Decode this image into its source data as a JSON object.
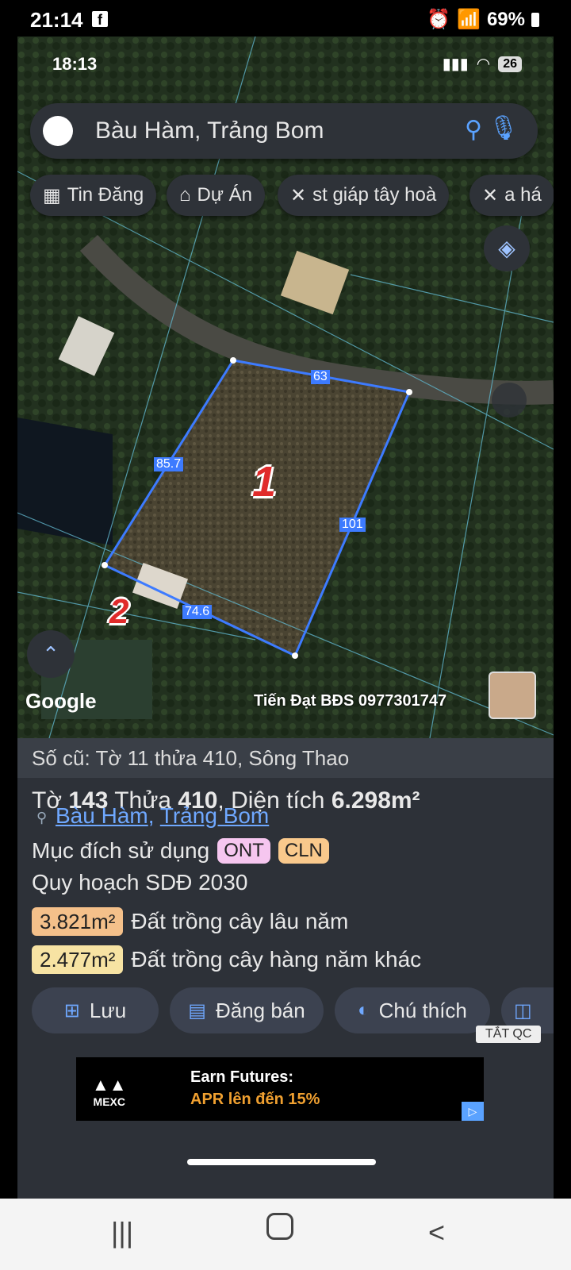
{
  "outer_status": {
    "time": "21:14",
    "fb": "f",
    "battery": "69%"
  },
  "inner_status": {
    "time": "18:13",
    "battery": "26"
  },
  "search": {
    "value": "Bàu Hàm, Trảng Bom"
  },
  "chips": [
    {
      "label": "Tin Đăng",
      "icon": "table-icon"
    },
    {
      "label": "Dự Án",
      "icon": "building-icon"
    },
    {
      "label": "st giáp tây hoà",
      "icon": "pattern-icon"
    },
    {
      "label": "a há",
      "icon": "pattern-icon"
    }
  ],
  "map": {
    "edges": {
      "top": "63",
      "left": "85.7",
      "right": "101",
      "bottom": "74.6"
    },
    "markers": {
      "one": "1",
      "two": "2"
    },
    "google": "Google",
    "watermark": "Tiến Đạt BĐS 0977301747"
  },
  "info": {
    "old": "Số cũ: Tờ 11 thửa 410, Sông Thao",
    "parcel_prefix": "Tờ",
    "sheet": "143",
    "plot_label": "Thửa",
    "plot": "410",
    "area_label": "Diện tích",
    "area": "6.298m²",
    "loc1": "Bàu Hàm",
    "loc_sep": ",",
    "loc2": "Trảng Bom",
    "purpose_label": "Mục đích sử dụng",
    "tag1": "ONT",
    "tag2": "CLN",
    "planning": "Quy hoạch SDĐ 2030",
    "rows": [
      {
        "area": "3.821m²",
        "desc": "Đất trồng cây lâu năm",
        "color": "#f4c08a"
      },
      {
        "area": "2.477m²",
        "desc": "Đất trồng cây hàng năm khác",
        "color": "#f7e3a3"
      }
    ],
    "tag1_color": "#f6c6ef",
    "tag2_color": "#f9c98c"
  },
  "actions": [
    {
      "label": "Lưu"
    },
    {
      "label": "Đăng bán"
    },
    {
      "label": "Chú thích"
    }
  ],
  "ad": {
    "close": "TẮT QC",
    "brand": "MEXC",
    "title": "Earn Futures:",
    "sub": "APR lên đến 15%"
  }
}
